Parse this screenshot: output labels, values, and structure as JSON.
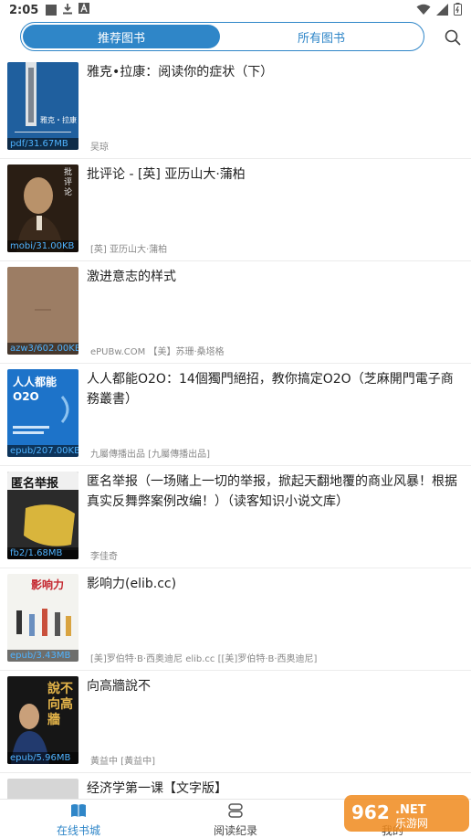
{
  "status_bar": {
    "time": "2:05"
  },
  "header": {
    "tab_recommended": "推荐图书",
    "tab_all": "所有图书"
  },
  "books": [
    {
      "title": "雅克•拉康：阅读你的症状（下）",
      "author": "吴琼",
      "format": "pdf/31.67MB",
      "cover_text": "雅克・拉康"
    },
    {
      "title": "批评论 - [英] 亚历山大·蒲柏",
      "author": "[英] 亚历山大·蒲柏",
      "format": "mobi/31.00KB",
      "cover_text": "批评论"
    },
    {
      "title": "激进意志的样式",
      "author": "ePUBw.COM 【美】苏珊·桑塔格",
      "format": "azw3/602.00KB",
      "cover_text": ""
    },
    {
      "title": "人人都能O2O：14個獨門絕招，教你搞定O2O（芝麻開門電子商務叢書）",
      "author": "九屬傳播出品 [九屬傳播出品]",
      "format": "epub/207.00KB",
      "cover_text": "人人都能 O2O"
    },
    {
      "title": "匿名举报（一场赌上一切的举报，掀起天翻地覆的商业风暴！根据真实反舞弊案例改编！）（读客知识小说文库）",
      "author": "李佳奇",
      "format": "fb2/1.68MB",
      "cover_text": "匿名举报"
    },
    {
      "title": "影响力(elib.cc)",
      "author": "[美]罗伯特·B·西奥迪尼 elib.cc [[美]罗伯特·B·西奥迪尼]",
      "format": "epub/3.43MB",
      "cover_text": "影响力"
    },
    {
      "title": "向高牆說不",
      "author": "黃益中 [黃益中]",
      "format": "epub/5.96MB",
      "cover_text": "說不 向高牆"
    },
    {
      "title": "经济学第一课【文字版】",
      "author": "",
      "format": "",
      "cover_text": ""
    }
  ],
  "tabbar": {
    "online": "在线书城",
    "history": "阅读纪录",
    "mine": "我的"
  },
  "colors": {
    "accent": "#2f86c8",
    "format_text": "#4fb3ff"
  }
}
